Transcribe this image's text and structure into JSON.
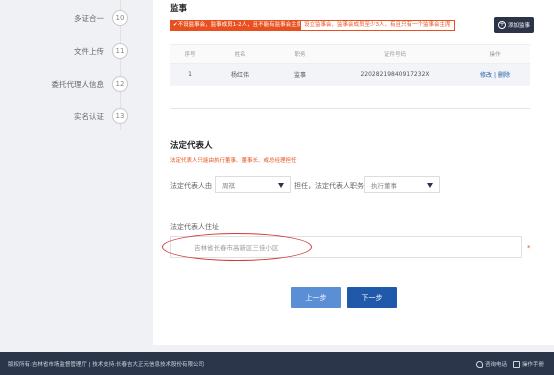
{
  "steps": [
    {
      "label": "多证合一",
      "num": "10"
    },
    {
      "label": "文件上传",
      "num": "11"
    },
    {
      "label": "委托代理人信息",
      "num": "12"
    },
    {
      "label": "实名认证",
      "num": "13"
    }
  ],
  "supervisor": {
    "title": "监事",
    "warning1": "✔不设监事会，监事成员1-2人，且不能有监事会主席",
    "warning2": "设立监事会，监事会成员至少3人，有且只有一个监事会主席",
    "add_label": "添加监事",
    "columns": [
      "序号",
      "姓名",
      "职务",
      "证件号码",
      "操作"
    ],
    "rows": [
      {
        "index": "1",
        "name": "杨红伟",
        "role": "监事",
        "id": "2202821984091​7232X",
        "edit": "修改",
        "sep": "|",
        "del": "删除"
      }
    ]
  },
  "legal": {
    "title": "法定代表人",
    "hint": "法定代表人只能由执行董事、董事长、或总经理担任",
    "label_from": "法定代表人由",
    "select1": "周祺",
    "label_role": "担任，法定代表人职务",
    "select2": "执行董事",
    "addr_label": "法定代表人住址",
    "addr_value": "吉林省长春市高新区三佳小区",
    "required_mark": "*"
  },
  "buttons": {
    "prev": "上一步",
    "next": "下一步"
  },
  "footer": {
    "copyright": "版权所有:吉林省市场监督管理厅 | 技术支持:长春吉大正元信息技术股份有限公司",
    "phone": "咨询电话",
    "manual": "操作手册"
  }
}
